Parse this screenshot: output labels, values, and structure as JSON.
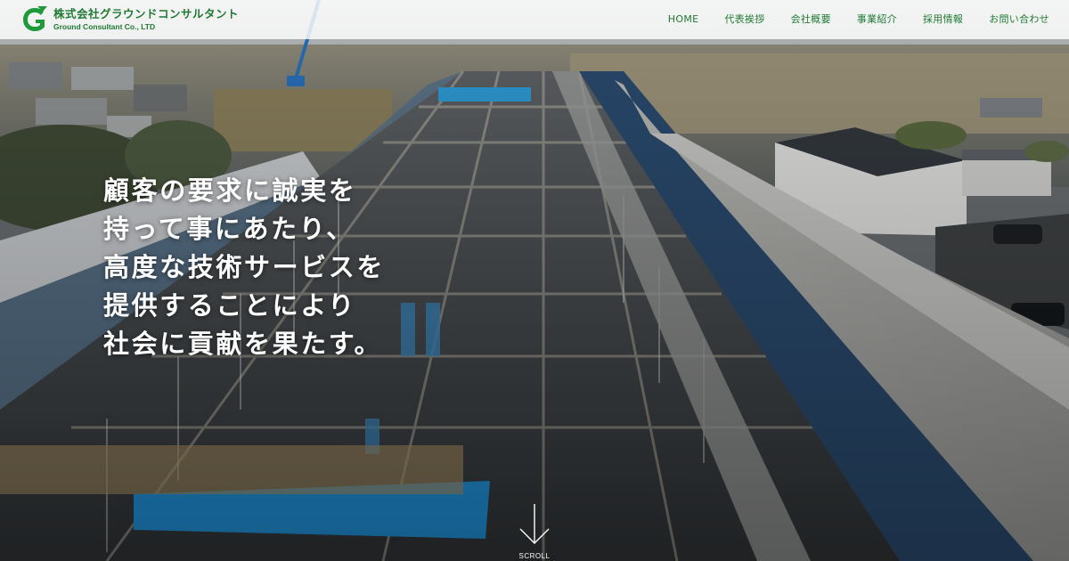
{
  "header": {
    "company_name_ja": "株式会社グラウンドコンサルタント",
    "company_name_en": "Ground Consultant Co., LTD",
    "logo_letter": "G",
    "logo_icon": "company-logo-icon",
    "brand_color": "#1f7a32"
  },
  "nav": {
    "items": [
      {
        "label": "HOME"
      },
      {
        "label": "代表挨拶"
      },
      {
        "label": "会社概要"
      },
      {
        "label": "事業紹介"
      },
      {
        "label": "採用情報"
      },
      {
        "label": "お問い合わせ"
      }
    ]
  },
  "hero": {
    "lines": [
      "顧客の要求に誠実を",
      "持って事にあたり、",
      "高度な技術サービスを",
      "提供することにより",
      "社会に貢献を果たす。"
    ]
  },
  "scroll": {
    "label": "SCROLL",
    "icon": "arrow-down-icon"
  }
}
